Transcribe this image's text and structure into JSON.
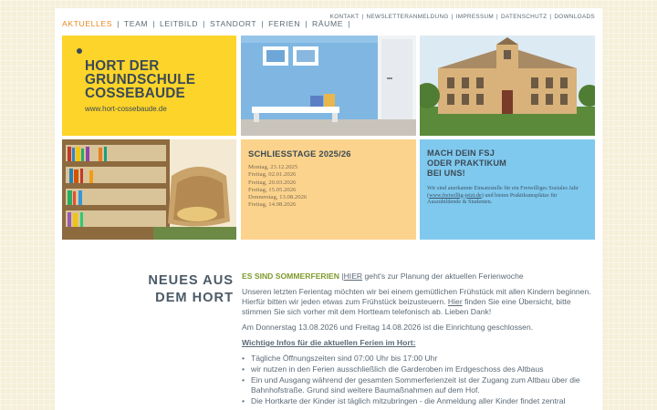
{
  "nav": {
    "main": [
      "AKTUELLES",
      "TEAM",
      "LEITBILD",
      "STANDORT",
      "FERIEN",
      "RÄUME"
    ],
    "meta": [
      "KONTAKT",
      "NEWSLETTERANMELDUNG",
      "IMPRESSUM",
      "DATENSCHUTZ",
      "DOWNLOADS"
    ],
    "separator": "|"
  },
  "logo": {
    "line1": "HORT DER",
    "line2": "GRUNDSCHULE",
    "line3": "COSSEBAUDE",
    "url": "www.hort-cossebaude.de"
  },
  "closing_days": {
    "title": "SCHLIESSTAGE 2025/26",
    "dates": [
      "Montag, 23.12.2025",
      "Freitag, 02.01.2026",
      "Freitag, 20.03.2026",
      "Freitag, 15.05.2026",
      "Donnerstag, 13.08.2026",
      "Freitag, 14.08.2026"
    ]
  },
  "fsj": {
    "title_line1": "MACH DEIN FSJ",
    "title_line2": "ODER PRAKTIKUM",
    "title_line3": "BEI UNS!",
    "text_before": "Wir sind anerkannte Einsatzstelle für ein Freiwilliges Soziales Jahr (",
    "link": "www.freiwillig-jetzt.de",
    "text_after": ") und bieten Praktikumsplätze für Auszubildende & Studenten."
  },
  "news": {
    "heading_line1": "NEUES AUS",
    "heading_line2": "DEM HORT",
    "lead_green": "ES SIND SOMMERFERIEN",
    "lead_sep": " |",
    "lead_link": "HIER",
    "lead_rest": " geht's zur Planung der aktuellen Ferienwoche",
    "para1_before": "Unseren letzten Ferientag möchten wir bei einem gemütlichen Frühstück mit allen Kindern beginnen. Hierfür bitten wir jeden etwas zum Frühstück beizusteuern. ",
    "para1_link": "Hier",
    "para1_after": " finden Sie eine Übersicht, bitte stimmen Sie sich vorher mit dem Hortteam telefonisch ab. Lieben Dank!",
    "para2": "Am Donnerstag 13.08.2026 und Freitag 14.08.2026 ist die Einrichtung geschlossen.",
    "info_heading": "Wichtige Infos für die aktuellen Ferien im Hort:",
    "bullets": [
      "Tägliche Öffnungszeiten sind 07:00 Uhr bis 17:00 Uhr",
      "wir nutzen in den Ferien ausschließlich die Garderoben im Erdgeschoss des Altbaus",
      "Ein und Ausgang während der gesamten Sommerferienzeit ist der Zugang zum Altbau über die Bahnhofstraße. Grund sind weitere Baumaßnahmen auf dem Hof.",
      "Die Hortkarte der Kinder ist täglich mitzubringen - die Anmeldung aller Kinder findet zentral"
    ]
  },
  "colors": {
    "yellow_tile": "#fdd42a",
    "peach_tile": "#fcd38c",
    "blue_tile": "#80c9ee",
    "active_nav": "#e58b22",
    "green_headline": "#7d9a2c"
  }
}
